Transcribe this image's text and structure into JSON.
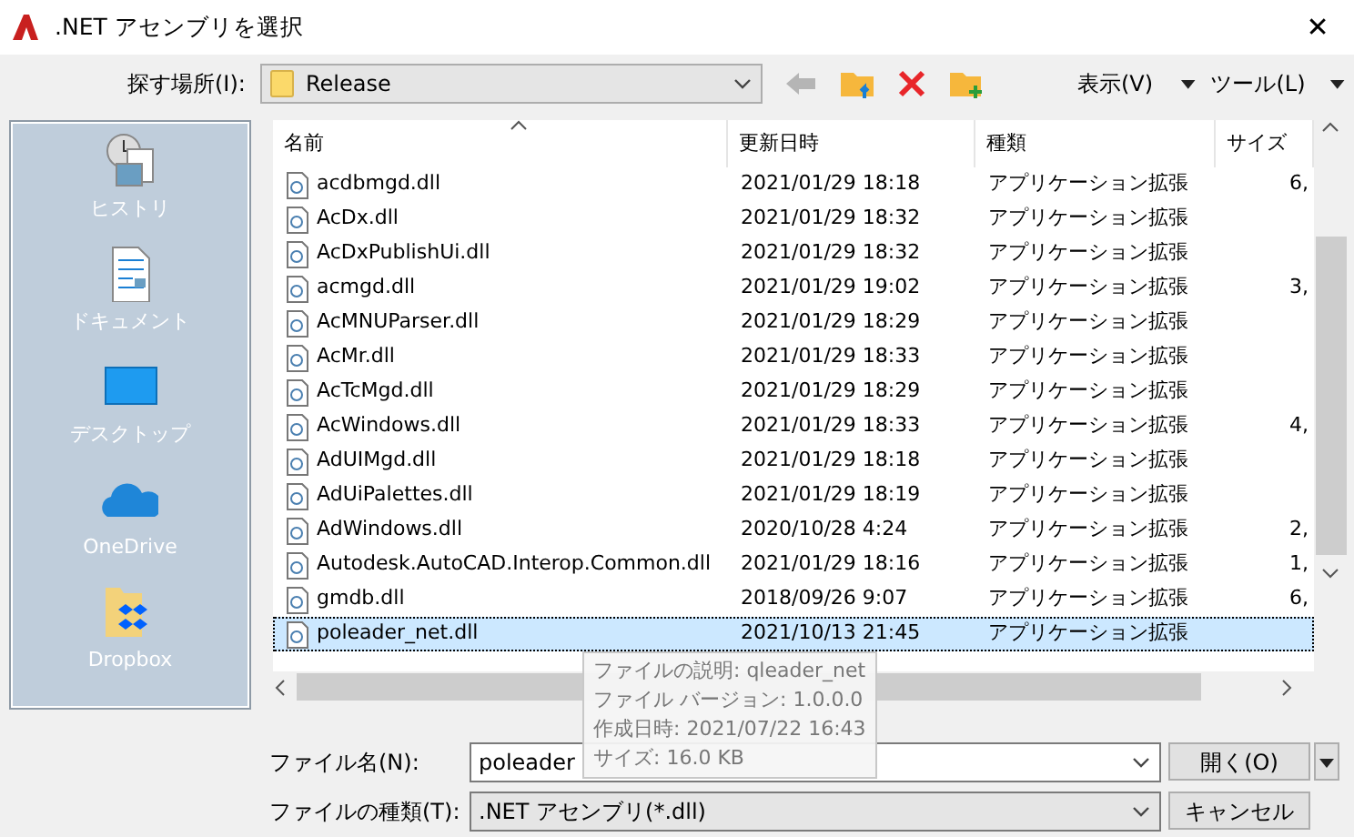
{
  "window": {
    "title": ".NET アセンブリを選択",
    "close": "✕"
  },
  "toolbar": {
    "look_in_label": "探す場所(I):",
    "folder": "Release",
    "view_menu": "表示(V)",
    "tools_menu": "ツール(L)"
  },
  "sidebar": {
    "items": [
      {
        "kind": "history",
        "label": "ヒストリ"
      },
      {
        "kind": "documents",
        "label": "ドキュメント"
      },
      {
        "kind": "desktop",
        "label": "デスクトップ"
      },
      {
        "kind": "onedrive",
        "label": "OneDrive"
      },
      {
        "kind": "dropbox",
        "label": "Dropbox"
      }
    ]
  },
  "table": {
    "columns": [
      "名前",
      "更新日時",
      "種類",
      "サイズ"
    ],
    "rows": [
      {
        "name": "acdbmgd.dll",
        "date": "2021/01/29 18:18",
        "type": "アプリケーション拡張",
        "size": "6,",
        "selected": false
      },
      {
        "name": "AcDx.dll",
        "date": "2021/01/29 18:32",
        "type": "アプリケーション拡張",
        "size": "",
        "selected": false
      },
      {
        "name": "AcDxPublishUi.dll",
        "date": "2021/01/29 18:32",
        "type": "アプリケーション拡張",
        "size": "",
        "selected": false
      },
      {
        "name": "acmgd.dll",
        "date": "2021/01/29 19:02",
        "type": "アプリケーション拡張",
        "size": "3,",
        "selected": false
      },
      {
        "name": "AcMNUParser.dll",
        "date": "2021/01/29 18:29",
        "type": "アプリケーション拡張",
        "size": "",
        "selected": false
      },
      {
        "name": "AcMr.dll",
        "date": "2021/01/29 18:33",
        "type": "アプリケーション拡張",
        "size": "",
        "selected": false
      },
      {
        "name": "AcTcMgd.dll",
        "date": "2021/01/29 18:29",
        "type": "アプリケーション拡張",
        "size": "",
        "selected": false
      },
      {
        "name": "AcWindows.dll",
        "date": "2021/01/29 18:33",
        "type": "アプリケーション拡張",
        "size": "4,",
        "selected": false
      },
      {
        "name": "AdUIMgd.dll",
        "date": "2021/01/29 18:18",
        "type": "アプリケーション拡張",
        "size": "",
        "selected": false
      },
      {
        "name": "AdUiPalettes.dll",
        "date": "2021/01/29 18:19",
        "type": "アプリケーション拡張",
        "size": "",
        "selected": false
      },
      {
        "name": "AdWindows.dll",
        "date": "2020/10/28 4:24",
        "type": "アプリケーション拡張",
        "size": "2,",
        "selected": false
      },
      {
        "name": "Autodesk.AutoCAD.Interop.Common.dll",
        "date": "2021/01/29 18:16",
        "type": "アプリケーション拡張",
        "size": "1,",
        "selected": false
      },
      {
        "name": "gmdb.dll",
        "date": "2018/09/26 9:07",
        "type": "アプリケーション拡張",
        "size": "6,",
        "selected": false
      },
      {
        "name": "poleader_net.dll",
        "date": "2021/10/13 21:45",
        "type": "アプリケーション拡張",
        "size": "",
        "selected": true
      }
    ]
  },
  "tooltip": [
    "ファイルの説明: qleader_net",
    "ファイル バージョン: 1.0.0.0",
    "作成日時: 2021/07/22 16:43",
    "サイズ: 16.0 KB"
  ],
  "file_name": {
    "label": "ファイル名(N):",
    "value": "poleader"
  },
  "file_type": {
    "label": "ファイルの種類(T):",
    "value": ".NET アセンブリ(*.dll)"
  },
  "buttons": {
    "open": "開く(O)",
    "cancel": "キャンセル"
  }
}
